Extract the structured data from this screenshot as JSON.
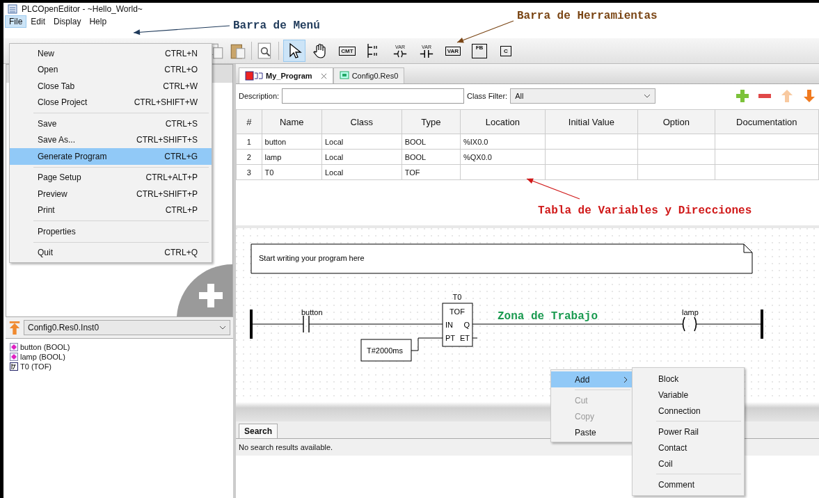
{
  "window": {
    "title": "PLCOpenEditor - ~Hello_World~"
  },
  "menu_bar": [
    {
      "label": "File",
      "selected": true
    },
    {
      "label": "Edit",
      "selected": false
    },
    {
      "label": "Display",
      "selected": false
    },
    {
      "label": "Help",
      "selected": false
    }
  ],
  "file_menu": [
    [
      {
        "label": "New",
        "shortcut": "CTRL+N",
        "selected": false
      },
      {
        "label": "Open",
        "shortcut": "CTRL+O",
        "selected": false
      },
      {
        "label": "Close Tab",
        "shortcut": "CTRL+W",
        "selected": false
      },
      {
        "label": "Close Project",
        "shortcut": "CTRL+SHIFT+W",
        "selected": false
      }
    ],
    [
      {
        "label": "Save",
        "shortcut": "CTRL+S",
        "selected": false
      },
      {
        "label": "Save As...",
        "shortcut": "CTRL+SHIFT+S",
        "selected": false
      },
      {
        "label": "Generate Program",
        "shortcut": "CTRL+G",
        "selected": true
      }
    ],
    [
      {
        "label": "Page Setup",
        "shortcut": "CTRL+ALT+P",
        "selected": false
      },
      {
        "label": "Preview",
        "shortcut": "CTRL+SHIFT+P",
        "selected": false
      },
      {
        "label": "Print",
        "shortcut": "CTRL+P",
        "selected": false
      }
    ],
    [
      {
        "label": "Properties",
        "selected": false
      }
    ],
    [
      {
        "label": "Quit",
        "shortcut": "CTRL+Q",
        "selected": false
      }
    ]
  ],
  "toolbar": [
    {
      "kind": "copy"
    },
    {
      "kind": "paste"
    },
    {
      "kind": "preview"
    },
    {
      "kind": "pointer",
      "selected": true
    },
    {
      "kind": "hand",
      "selected": false
    },
    {
      "kind": "comment",
      "label": "CMT",
      "selected": false
    },
    {
      "kind": "rail",
      "selected": false
    },
    {
      "kind": "coil",
      "label": "VAR",
      "selected": false
    },
    {
      "kind": "contact",
      "label": "VAR",
      "selected": false
    },
    {
      "kind": "variable",
      "label": "VAR",
      "selected": false
    },
    {
      "kind": "block",
      "label": "FB",
      "selected": false
    },
    {
      "kind": "connection",
      "label": "C",
      "selected": false
    }
  ],
  "annotations": [
    {
      "kind": "menu",
      "text": "Barra de Menú",
      "color": "#1f3a5a"
    },
    {
      "kind": "toolbar",
      "text": "Barra de Herramientas",
      "color": "#7a4514"
    },
    {
      "kind": "table",
      "text": "Tabla de Variables y Direcciones",
      "color": "#d01818"
    },
    {
      "kind": "workspace",
      "text": "Zona de Trabajo",
      "color": "#1a9a50"
    }
  ],
  "left_panel": {
    "instance": "Config0.Res0.Inst0",
    "variables": [
      {
        "label": "button (BOOL)",
        "kind": "variable"
      },
      {
        "label": "lamp (BOOL)",
        "kind": "variable"
      },
      {
        "label": "T0 (TOF)",
        "kind": "function_block"
      }
    ]
  },
  "editor_tabs": [
    {
      "label": "My_Program",
      "selected": true,
      "closable": true
    },
    {
      "label": "Config0.Res0",
      "selected": false,
      "closable": false
    }
  ],
  "description": {
    "label": "Description:"
  },
  "class_filter": {
    "label": "Class Filter:",
    "value": "All"
  },
  "table": {
    "columns": [
      "#",
      "Name",
      "Class",
      "Type",
      "Location",
      "Initial Value",
      "Option",
      "Documentation"
    ],
    "rows": [
      [
        "1",
        "button",
        "Local",
        "BOOL",
        "%IX0.0",
        "",
        "",
        ""
      ],
      [
        "2",
        "lamp",
        "Local",
        "BOOL",
        "%QX0.0",
        "",
        "",
        ""
      ],
      [
        "3",
        "T0",
        "Local",
        "TOF",
        "",
        "",
        "",
        ""
      ]
    ]
  },
  "diagram": {
    "comment": "Start writing your program here",
    "contact": "button",
    "block": {
      "name": "T0",
      "type": "TOF",
      "inputs": [
        "IN",
        "PT"
      ],
      "outputs": [
        "Q",
        "ET"
      ]
    },
    "constant": "T#2000ms",
    "coil": "lamp"
  },
  "context_menu": {
    "items": [
      {
        "label": "Add",
        "selected": true,
        "disabled": false,
        "submenu": true
      },
      {
        "label": "Cut",
        "selected": false,
        "disabled": true
      },
      {
        "label": "Copy",
        "selected": false,
        "disabled": true
      },
      {
        "label": "Paste",
        "selected": false,
        "disabled": false
      }
    ],
    "submenu": [
      [
        "Block",
        "Variable",
        "Connection"
      ],
      [
        "Power Rail",
        "Contact",
        "Coil"
      ],
      [
        "Comment"
      ]
    ]
  },
  "search": {
    "tab": "Search",
    "message": "No search results available."
  }
}
